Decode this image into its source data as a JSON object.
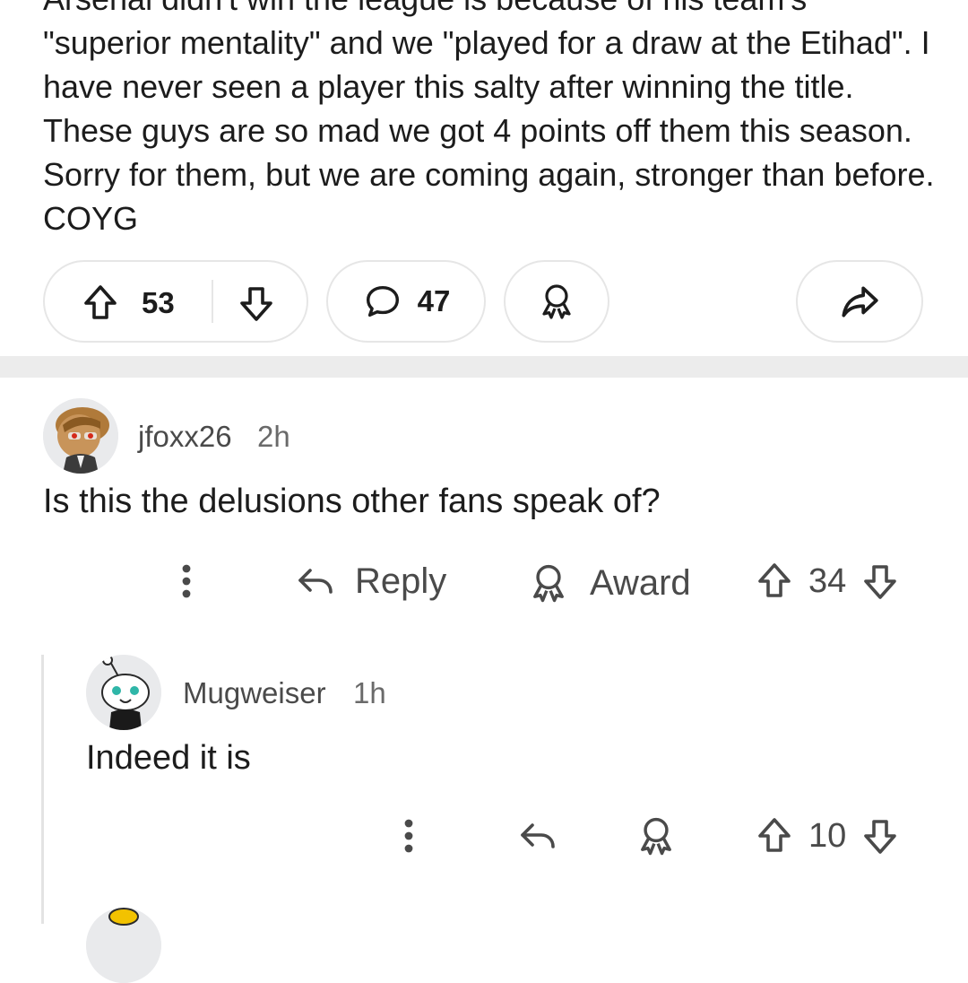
{
  "post": {
    "body": "Arsenal didn't win the league is because of his team's \"superior mentality\" and we \"played for a draw at the Etihad\". I have never seen a player this salty after winning the title. These guys are so mad we got 4 points off them this season. Sorry for them, but we are coming again, stronger than before. COYG",
    "upvotes": "53",
    "comments": "47"
  },
  "comments": [
    {
      "username": "jfoxx26",
      "time": "2h",
      "text": "Is this the delusions other fans speak of?",
      "reply_label": "Reply",
      "award_label": "Award",
      "votes": "34"
    },
    {
      "username": "Mugweiser",
      "time": "1h",
      "text": "Indeed it is",
      "votes": "10"
    }
  ],
  "icons": {
    "upvote": "upvote-arrow-icon",
    "downvote": "downvote-arrow-icon",
    "comment": "speech-bubble-icon",
    "award": "award-ribbon-icon",
    "share": "share-arrow-icon",
    "more": "vertical-ellipsis-icon",
    "reply": "reply-arrow-icon"
  },
  "colors": {
    "text": "#1c1c1c",
    "muted": "#4a4a4a",
    "border": "#e6e6e6",
    "band": "#ececec"
  }
}
